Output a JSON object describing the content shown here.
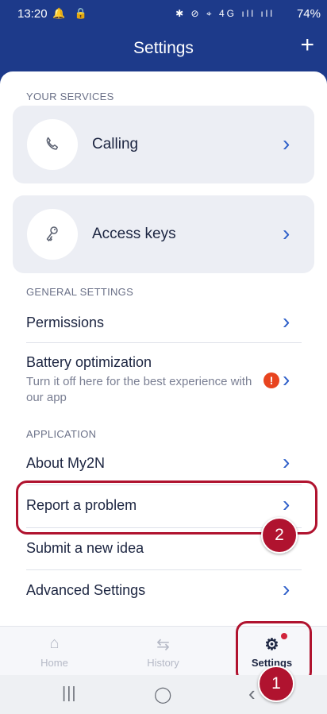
{
  "status_bar": {
    "time": "13:20",
    "left_icons": "🔔 🔒",
    "right_icons": "✱ ⊘ ⌖ 4G ıll ıll",
    "battery": "74%"
  },
  "header": {
    "title": "Settings",
    "add_label": "+"
  },
  "your_services": {
    "section_label": "YOUR SERVICES",
    "cards": [
      {
        "label": "Calling",
        "icon": "phone-icon"
      },
      {
        "label": "Access keys",
        "icon": "keys-icon"
      }
    ]
  },
  "general_settings": {
    "section_label": "GENERAL SETTINGS",
    "permissions": "Permissions",
    "battery": {
      "label": "Battery optimization",
      "sub": "Turn it off here for the best experience with our app",
      "warn": "!"
    }
  },
  "application": {
    "section_label": "APPLICATION",
    "items": [
      "About My2N",
      "Report a problem",
      "Submit a new idea",
      "Advanced Settings"
    ]
  },
  "chevron": "›",
  "annotations": {
    "step1": "1",
    "step2": "2"
  },
  "tabs": [
    {
      "label": "Home",
      "icon": "home-icon",
      "glyph": "⌂"
    },
    {
      "label": "History",
      "icon": "history-icon",
      "glyph": "⇆"
    },
    {
      "label": "Settings",
      "icon": "gear-icon",
      "glyph": "⚙"
    }
  ],
  "nav": {
    "recents": "|||",
    "home": "◯",
    "back": "‹"
  },
  "colors": {
    "header": "#1d3a8a",
    "accent": "#2e5fc9",
    "highlight": "#b0132f",
    "warning": "#e8441f"
  }
}
